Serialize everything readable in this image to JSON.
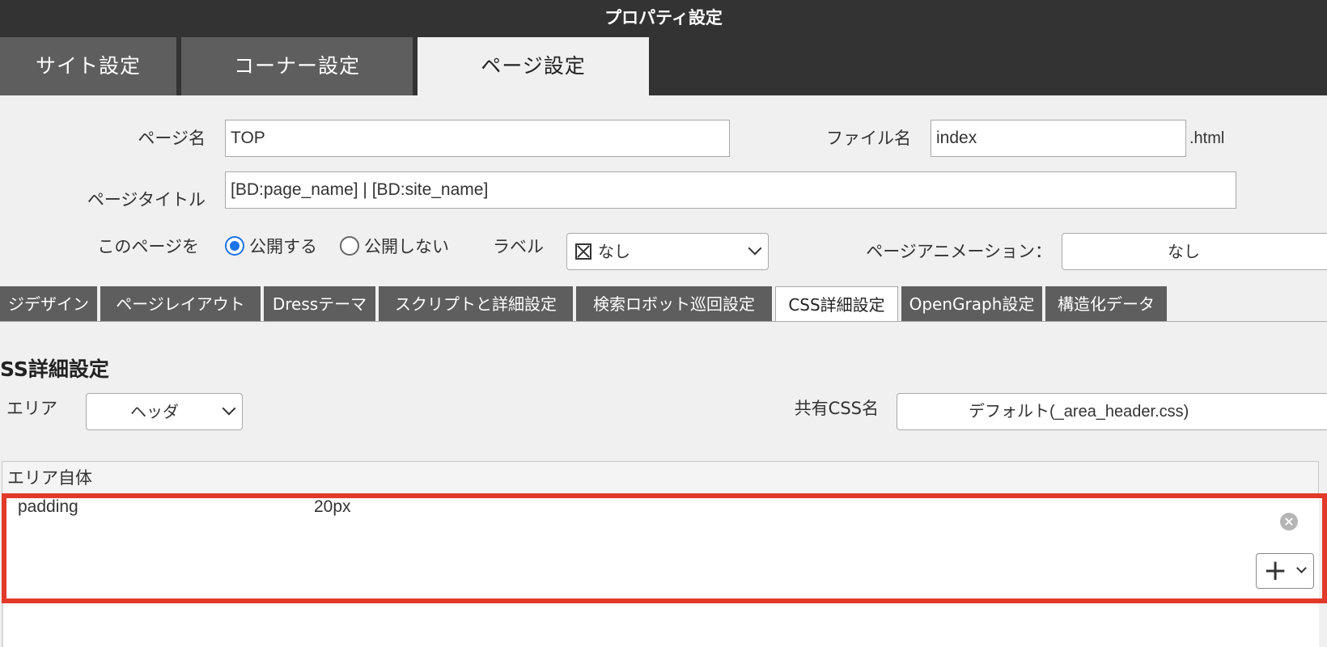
{
  "window": {
    "title": "プロパティ設定"
  },
  "main_tabs": [
    {
      "label": "サイト設定",
      "active": false
    },
    {
      "label": "コーナー設定",
      "active": false
    },
    {
      "label": "ページ設定",
      "active": true
    }
  ],
  "form": {
    "page_name_label": "ページ名",
    "page_name_value": "TOP",
    "file_name_label": "ファイル名",
    "file_name_value": "index",
    "file_ext": ".html",
    "page_title_label": "ページタイトル",
    "page_title_value": "[BD:page_name] | [BD:site_name]",
    "publish_label": "このページを",
    "publish_options": [
      {
        "label": "公開する",
        "checked": true
      },
      {
        "label": "公開しない",
        "checked": false
      }
    ],
    "label_label": "ラベル",
    "label_value": "なし",
    "label_icon": "box-x-icon",
    "animation_label": "ページアニメーション：",
    "animation_value": "なし"
  },
  "sub_tabs": [
    {
      "label": "ジデザイン",
      "active": false
    },
    {
      "label": "ページレイアウト",
      "active": false
    },
    {
      "label": "Dressテーマ",
      "active": false
    },
    {
      "label": "スクリプトと詳細設定",
      "active": false
    },
    {
      "label": "検索ロボット巡回設定",
      "active": false
    },
    {
      "label": "CSS詳細設定",
      "active": true
    },
    {
      "label": "OpenGraph設定",
      "active": false
    },
    {
      "label": "構造化データ",
      "active": false
    }
  ],
  "css_section": {
    "heading": "SS詳細設定",
    "area_label": "エリア",
    "area_value": "ヘッダ",
    "shared_css_label": "共有CSS名",
    "shared_css_value": "デフォルト(_area_header.css)",
    "panel_header": "エリア自体",
    "properties": [
      {
        "name": "padding",
        "value": "20px"
      }
    ],
    "add_button": "+"
  },
  "colors": {
    "titlebar": "#333333",
    "inactive_tab": "#5e5e5e",
    "radio_checked": "#1a73e8",
    "highlight": "#e23a2a"
  }
}
